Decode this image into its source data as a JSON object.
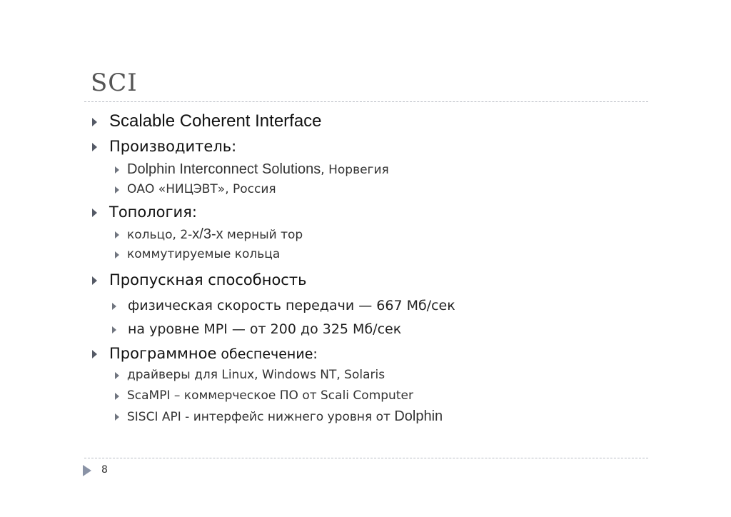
{
  "slide": {
    "title": "SCI",
    "page_number": "8"
  },
  "bullets": {
    "b1": {
      "text": "Scalable Coherent Interface"
    },
    "b2": {
      "text": "Производитель:",
      "sub1_a": "Dolphin Interconnect Solutions",
      "sub1_b": ", Норвегия",
      "sub2": "ОАО «НИЦЭВТ», Россия"
    },
    "b3": {
      "text": "Топология:",
      "sub1_a": "кольцо, 2-",
      "sub1_b": "x/3-x",
      "sub1_c": " мерный тор",
      "sub2": "коммутируемые кольца"
    },
    "b4": {
      "text": "Пропускная способность",
      "sub1": "физическая скорость передачи — 667 Мб/сек",
      "sub2": "на уровне MPI — от 200 до 325 Мб/сек"
    },
    "b5": {
      "text_a": "Программное",
      "text_b": " обеспечение:",
      "sub1": "драйверы для Linux, Windows NT, Solaris",
      "sub2": "ScaMPI – коммерческое ПО от Scali Computer",
      "sub3_a": "SISCI API - интерфейс нижнего уровня от ",
      "sub3_b": "Dolphin"
    }
  }
}
